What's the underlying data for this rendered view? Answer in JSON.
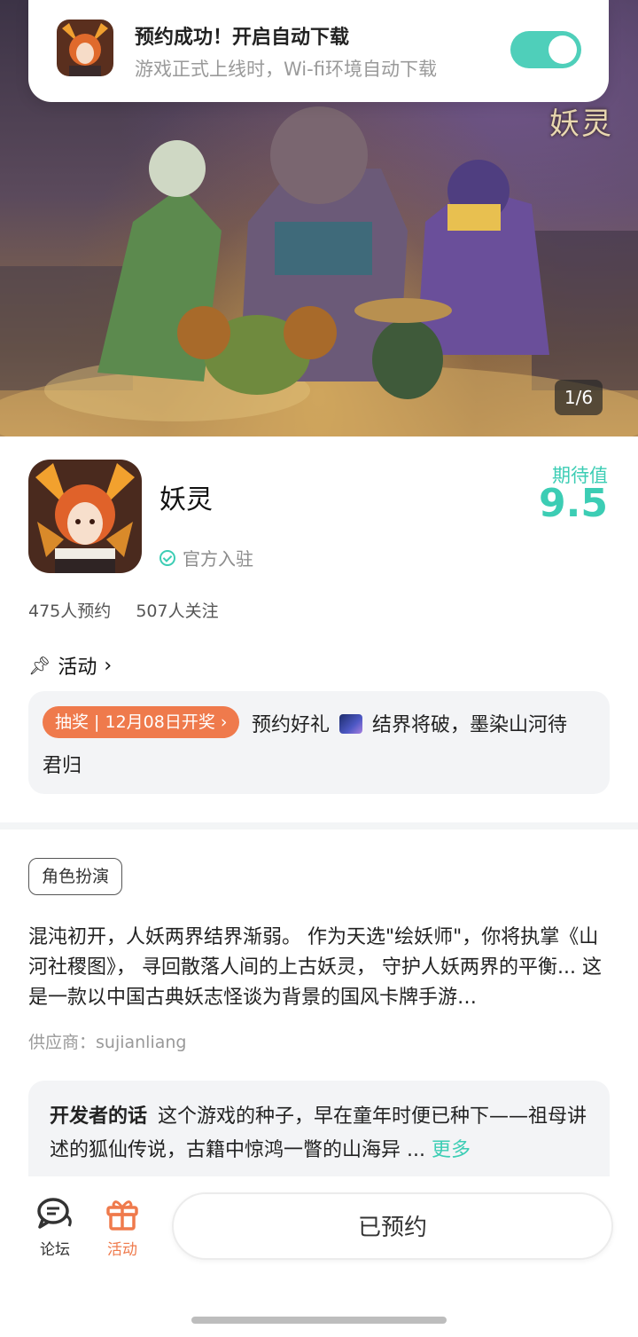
{
  "toast": {
    "title": "预约成功！开启自动下载",
    "subtitle": "游戏正式上线时，Wi-fi环境自动下载",
    "auto_download_on": true,
    "toggle_color": "#4fcfba"
  },
  "banner": {
    "logo_text": "妖灵",
    "page_indicator": "1/6"
  },
  "game": {
    "name": "妖灵",
    "verified_label": "官方入驻",
    "expect_label": "期待值",
    "expect_score": "9.5",
    "reservations": "475人预约",
    "followers": "507人关注"
  },
  "activity": {
    "heading": "活动",
    "badge": "抽奖 | 12月08日开奖 ›",
    "text_line1_a": "预约好礼",
    "text_line1_b": "结界将破，墨染山河待",
    "text_line2": "君归"
  },
  "info": {
    "tag": "角色扮演",
    "description": "混沌初开，人妖两界结界渐弱。 作为天选\"绘妖师\"，你将执掌《山河社稷图》， 寻回散落人间的上古妖灵， 守护人妖两界的平衡... 这是一款以中国古典妖志怪谈为背景的国风卡牌手游…",
    "supplier": "供应商：sujianliang"
  },
  "developer": {
    "label": "开发者的话",
    "text": "这个游戏的种子，早在童年时便已种下——祖母讲述的狐仙传说，古籍中惊鸿一瞥的山海异 ...",
    "more": "更多"
  },
  "bottom_nav": {
    "forum_label": "论坛",
    "activity_label": "活动",
    "reserved_button": "已预约",
    "accent_color": "#ef7a4c"
  }
}
